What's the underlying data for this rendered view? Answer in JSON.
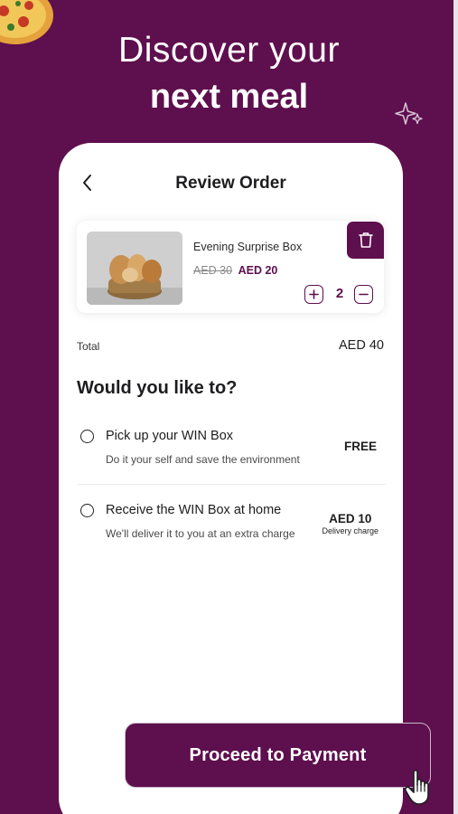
{
  "hero": {
    "line1": "Discover your",
    "line2": "next meal"
  },
  "screen": {
    "title": "Review Order",
    "back_icon": "chevron-left-icon"
  },
  "order_item": {
    "name": "Evening Surprise Box",
    "old_price": "AED 30",
    "new_price": "AED 20",
    "quantity": "2",
    "delete_icon": "trash-icon",
    "increase_icon": "plus-icon",
    "decrease_icon": "minus-icon"
  },
  "summary": {
    "total_label": "Total",
    "total_value": "AED 40"
  },
  "options": {
    "question": "Would you like to?",
    "pickup": {
      "title": "Pick up your WIN Box",
      "description": "Do it your self and save the environment",
      "price": "FREE"
    },
    "delivery": {
      "title": "Receive the WIN Box at home",
      "description": "We'll deliver it to you at an extra charge",
      "price": "AED 10",
      "price_note": "Delivery charge"
    }
  },
  "cta": {
    "label": "Proceed to Payment"
  },
  "colors": {
    "brand": "#5e0f4e",
    "background": "#5e0f4e",
    "card": "#ffffff"
  }
}
